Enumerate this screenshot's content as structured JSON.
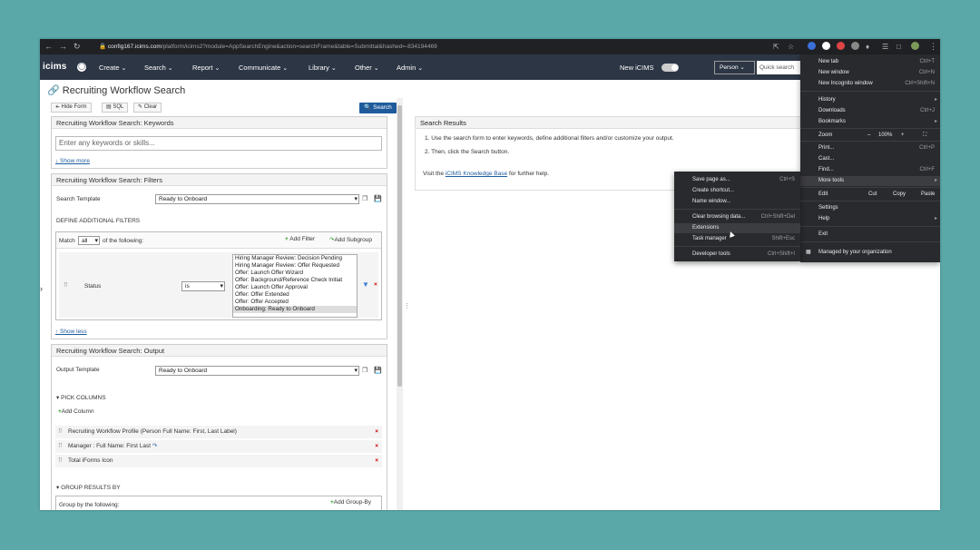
{
  "browser": {
    "url_host": "config167.icims.com",
    "url_path": "/platform/icims2?module=AppSearchEngine&action=searchFrame&table=Submittal&hashed=-834194469"
  },
  "nav": {
    "logo": "icims",
    "menus": [
      "Create",
      "Search",
      "Report",
      "Communicate",
      "Library",
      "Other",
      "Admin"
    ],
    "new_icims": "New iCIMS",
    "person": "Person",
    "quick_search": "Quick search"
  },
  "page": {
    "title": "Recruiting Workflow Search",
    "hide_form": "Hide Form",
    "sql": "SQL",
    "clear": "Clear",
    "search": "Search"
  },
  "keywords": {
    "header": "Recruiting Workflow Search: Keywords",
    "placeholder": "Enter any keywords or skills...",
    "show_more": "↓ Show more"
  },
  "filters": {
    "header": "Recruiting Workflow Search: Filters",
    "search_template_label": "Search Template",
    "search_template_value": "Ready to Onboard",
    "define_label": "DEFINE ADDITIONAL FILTERS",
    "match_prefix": "Match",
    "match_value": "all",
    "match_suffix": "of the following:",
    "add_filter": "Add Filter",
    "add_subgroup": "Add Subgroup",
    "field": "Status",
    "operator": "is",
    "status_options": [
      "Hiring Manager Review: Decision Pending",
      "Hiring Manager Review: Offer Requested",
      "Offer: Launch Offer Wizard",
      "Offer: Background/Reference Check Initiat",
      "Offer: Launch Offer Approval",
      "Offer: Offer Extended",
      "Offer: Offer Accepted",
      "Onboarding: Ready to Onboard"
    ],
    "show_less": "↑ Show less"
  },
  "output": {
    "header": "Recruiting Workflow Search: Output",
    "template_label": "Output Template",
    "template_value": "Ready to Onboard",
    "pick_columns": "PICK COLUMNS",
    "add_column": "Add Column",
    "columns": [
      "Recruiting Workflow Profile (Person Full Name: First, Last Label)",
      "Manager : Full Name: First Last",
      "Total iForms Icon"
    ],
    "group_results": "GROUP RESULTS BY",
    "group_by_label": "Group by the following:",
    "add_group_by": "Add Group-By"
  },
  "results": {
    "header": "Search Results",
    "step1": "1. Use the search form to enter keywords, define additional filters and/or customize your output.",
    "step2": "2. Then, click the Search button.",
    "visit_prefix": "Visit the",
    "kb_link": "iCIMS Knowledge Base",
    "visit_suffix": "for further help."
  },
  "chrome_menu": {
    "items": [
      {
        "label": "New tab",
        "shortcut": "Ctrl+T"
      },
      {
        "label": "New window",
        "shortcut": "Ctrl+N"
      },
      {
        "label": "New Incognito window",
        "shortcut": "Ctrl+Shift+N"
      },
      {
        "label": "History",
        "shortcut": ""
      },
      {
        "label": "Downloads",
        "shortcut": "Ctrl+J"
      },
      {
        "label": "Bookmarks",
        "shortcut": ""
      },
      {
        "label": "Zoom",
        "shortcut": ""
      },
      {
        "label": "Print...",
        "shortcut": "Ctrl+P"
      },
      {
        "label": "Cast...",
        "shortcut": ""
      },
      {
        "label": "Find...",
        "shortcut": "Ctrl+F"
      },
      {
        "label": "More tools",
        "shortcut": ""
      },
      {
        "label": "Edit",
        "shortcut": ""
      },
      {
        "label": "Settings",
        "shortcut": ""
      },
      {
        "label": "Help",
        "shortcut": ""
      },
      {
        "label": "Exit",
        "shortcut": ""
      },
      {
        "label": "Managed by your organization",
        "shortcut": ""
      }
    ],
    "zoom_minus": "–",
    "zoom_value": "100%",
    "zoom_plus": "+",
    "edit_cut": "Cut",
    "edit_copy": "Copy",
    "edit_paste": "Paste"
  },
  "more_tools": {
    "items": [
      {
        "label": "Save page as...",
        "shortcut": "Ctrl+S"
      },
      {
        "label": "Create shortcut...",
        "shortcut": ""
      },
      {
        "label": "Name window...",
        "shortcut": ""
      },
      {
        "label": "Clear browsing data...",
        "shortcut": "Ctrl+Shift+Del"
      },
      {
        "label": "Extensions",
        "shortcut": ""
      },
      {
        "label": "Task manager",
        "shortcut": "Shift+Esc"
      },
      {
        "label": "Developer tools",
        "shortcut": "Ctrl+Shift+I"
      }
    ]
  }
}
